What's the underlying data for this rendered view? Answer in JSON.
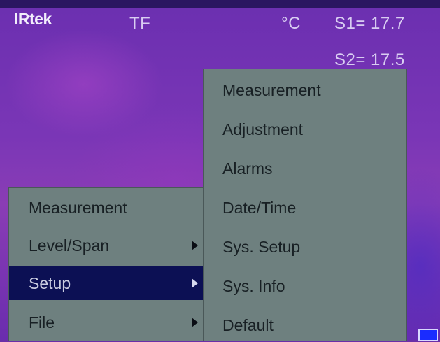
{
  "header": {
    "logo": "IRtek",
    "mode": "TF",
    "unit": "°C",
    "spot1": "S1= 17.7",
    "spot2": "S2= 17.5"
  },
  "main_menu": {
    "items": [
      {
        "label": "Measurement",
        "has_submenu": false,
        "selected": false
      },
      {
        "label": "Level/Span",
        "has_submenu": true,
        "selected": false
      },
      {
        "label": "Setup",
        "has_submenu": true,
        "selected": true
      },
      {
        "label": "File",
        "has_submenu": true,
        "selected": false
      }
    ]
  },
  "setup_submenu": {
    "items": [
      {
        "label": "Measurement"
      },
      {
        "label": "Adjustment"
      },
      {
        "label": "Alarms"
      },
      {
        "label": "Date/Time"
      },
      {
        "label": "Sys. Setup"
      },
      {
        "label": "Sys. Info"
      },
      {
        "label": "Default"
      }
    ]
  },
  "colors": {
    "menu_bg": "#6e807f",
    "selected_bg": "#0c1054",
    "thermal_bg": "#6a2fa8"
  }
}
